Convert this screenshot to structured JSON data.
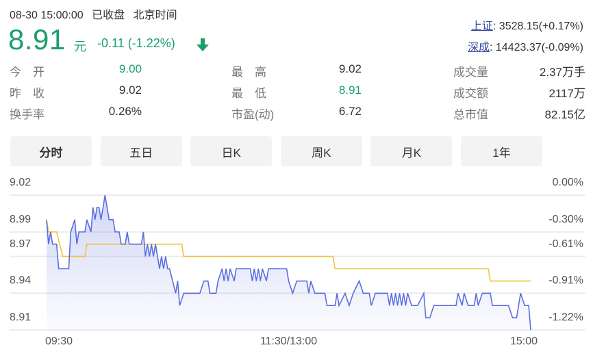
{
  "header": {
    "datetime": "08-30 15:00:00",
    "status": "已收盘",
    "timezone": "北京时间"
  },
  "quote": {
    "price": "8.91",
    "unit": "元",
    "change": "-0.11 (-1.22%)",
    "direction_icon": "arrow-down-icon"
  },
  "indices": [
    {
      "name": "上证",
      "value": ": 3528.15(+0.17%)"
    },
    {
      "name": "深成",
      "value": ": 14423.37(-0.09%)"
    }
  ],
  "stats": [
    {
      "label": "今　开",
      "value": "9.00",
      "color": "green"
    },
    {
      "label": "昨　收",
      "value": "9.02",
      "color": ""
    },
    {
      "label": "换手率",
      "value": "0.26%",
      "color": ""
    },
    {
      "label": "最　高",
      "value": "9.02",
      "color": ""
    },
    {
      "label": "最　低",
      "value": "8.91",
      "color": "green"
    },
    {
      "label": "市盈(动)",
      "value": "6.72",
      "color": ""
    },
    {
      "label": "成交量",
      "value": "2.37万手",
      "color": ""
    },
    {
      "label": "成交额",
      "value": "2117万",
      "color": ""
    },
    {
      "label": "总市值",
      "value": "82.15亿",
      "color": ""
    }
  ],
  "tabs": [
    "分时",
    "五日",
    "日K",
    "周K",
    "月K",
    "1年"
  ],
  "active_tab": 0,
  "colors": {
    "green": "#1a9f6b",
    "price_line": "#5b6ee1",
    "avg_line": "#f2c23e",
    "link": "#3a48a0"
  },
  "chart_data": {
    "type": "line",
    "x_unit": "minutes since 09:30 (trading minutes)",
    "xlim": [
      0,
      240
    ],
    "ylim": [
      8.91,
      9.02
    ],
    "y_ticks": [
      "9.02",
      "8.99",
      "8.97",
      "8.94",
      "8.91"
    ],
    "y_tick_values": [
      9.02,
      8.99,
      8.97,
      8.94,
      8.91
    ],
    "right_ticks": [
      "0.00%",
      "-0.30%",
      "-0.61%",
      "-0.91%",
      "-1.22%"
    ],
    "x_ticks": [
      {
        "label": "09:30",
        "x": 0
      },
      {
        "label": "11:30/13:00",
        "x": 120
      },
      {
        "label": "15:00",
        "x": 240
      }
    ],
    "grid": true,
    "series": [
      {
        "name": "price",
        "points": [
          [
            0,
            9.0
          ],
          [
            1,
            8.98
          ],
          [
            2,
            8.99
          ],
          [
            3,
            8.98
          ],
          [
            5,
            8.98
          ],
          [
            6,
            8.96
          ],
          [
            11,
            8.96
          ],
          [
            12,
            8.99
          ],
          [
            14,
            9.0
          ],
          [
            15,
            8.98
          ],
          [
            16,
            8.99
          ],
          [
            19,
            8.99
          ],
          [
            20,
            9.0
          ],
          [
            22,
            8.99
          ],
          [
            23,
            9.01
          ],
          [
            24,
            9.0
          ],
          [
            25,
            9.01
          ],
          [
            26,
            9.01
          ],
          [
            27,
            9.0
          ],
          [
            29,
            9.02
          ],
          [
            31,
            9.0
          ],
          [
            33,
            9.0
          ],
          [
            34,
            8.99
          ],
          [
            36,
            8.99
          ],
          [
            37,
            8.98
          ],
          [
            39,
            8.98
          ],
          [
            40,
            8.99
          ],
          [
            41,
            8.98
          ],
          [
            47,
            8.98
          ],
          [
            48,
            8.99
          ],
          [
            49,
            8.97
          ],
          [
            50,
            8.98
          ],
          [
            51,
            8.97
          ],
          [
            52,
            8.98
          ],
          [
            53,
            8.97
          ],
          [
            54,
            8.98
          ],
          [
            56,
            8.96
          ],
          [
            57,
            8.97
          ],
          [
            58,
            8.96
          ],
          [
            59,
            8.97
          ],
          [
            60,
            8.96
          ],
          [
            61,
            8.96
          ],
          [
            64,
            8.94
          ],
          [
            65,
            8.95
          ],
          [
            66,
            8.93
          ],
          [
            68,
            8.94
          ],
          [
            76,
            8.94
          ],
          [
            78,
            8.95
          ],
          [
            80,
            8.95
          ],
          [
            81,
            8.94
          ],
          [
            84,
            8.94
          ],
          [
            85,
            8.95
          ],
          [
            87,
            8.96
          ],
          [
            88,
            8.95
          ],
          [
            89,
            8.96
          ],
          [
            90,
            8.95
          ],
          [
            91,
            8.96
          ],
          [
            93,
            8.95
          ],
          [
            94,
            8.96
          ],
          [
            101,
            8.96
          ],
          [
            102,
            8.95
          ],
          [
            103,
            8.96
          ],
          [
            104,
            8.95
          ],
          [
            105,
            8.96
          ],
          [
            106,
            8.95
          ],
          [
            107,
            8.96
          ],
          [
            109,
            8.95
          ],
          [
            110,
            8.96
          ],
          [
            119,
            8.96
          ],
          [
            120,
            8.95
          ],
          [
            122,
            8.94
          ],
          [
            124,
            8.95
          ],
          [
            129,
            8.95
          ],
          [
            130,
            8.94
          ],
          [
            131,
            8.95
          ],
          [
            133,
            8.94
          ],
          [
            138,
            8.94
          ],
          [
            139,
            8.93
          ],
          [
            143,
            8.93
          ],
          [
            144,
            8.94
          ],
          [
            145,
            8.93
          ],
          [
            148,
            8.94
          ],
          [
            150,
            8.93
          ],
          [
            152,
            8.94
          ],
          [
            155,
            8.95
          ],
          [
            157,
            8.94
          ],
          [
            160,
            8.94
          ],
          [
            161,
            8.93
          ],
          [
            163,
            8.94
          ],
          [
            169,
            8.94
          ],
          [
            170,
            8.93
          ],
          [
            171,
            8.94
          ],
          [
            172,
            8.93
          ],
          [
            173,
            8.94
          ],
          [
            174,
            8.93
          ],
          [
            175,
            8.94
          ],
          [
            176,
            8.93
          ],
          [
            177,
            8.94
          ],
          [
            178,
            8.93
          ],
          [
            179,
            8.94
          ],
          [
            181,
            8.93
          ],
          [
            184,
            8.93
          ],
          [
            187,
            8.94
          ],
          [
            188,
            8.92
          ],
          [
            190,
            8.92
          ],
          [
            192,
            8.93
          ],
          [
            203,
            8.93
          ],
          [
            204,
            8.94
          ],
          [
            206,
            8.93
          ],
          [
            207,
            8.94
          ],
          [
            209,
            8.93
          ],
          [
            212,
            8.93
          ],
          [
            213,
            8.94
          ],
          [
            214,
            8.93
          ],
          [
            216,
            8.94
          ],
          [
            220,
            8.94
          ],
          [
            221,
            8.93
          ],
          [
            229,
            8.93
          ],
          [
            231,
            8.92
          ],
          [
            233,
            8.92
          ],
          [
            235,
            8.94
          ],
          [
            237,
            8.93
          ],
          [
            239,
            8.93
          ],
          [
            240,
            8.91
          ]
        ]
      },
      {
        "name": "average",
        "points": [
          [
            0,
            9.0
          ],
          [
            1,
            8.99
          ],
          [
            5,
            8.99
          ],
          [
            8,
            8.97
          ],
          [
            19,
            8.97
          ],
          [
            20,
            8.98
          ],
          [
            67,
            8.98
          ],
          [
            68,
            8.97
          ],
          [
            142,
            8.97
          ],
          [
            143,
            8.96
          ],
          [
            219,
            8.96
          ],
          [
            220,
            8.95
          ],
          [
            240,
            8.95
          ]
        ]
      }
    ]
  }
}
